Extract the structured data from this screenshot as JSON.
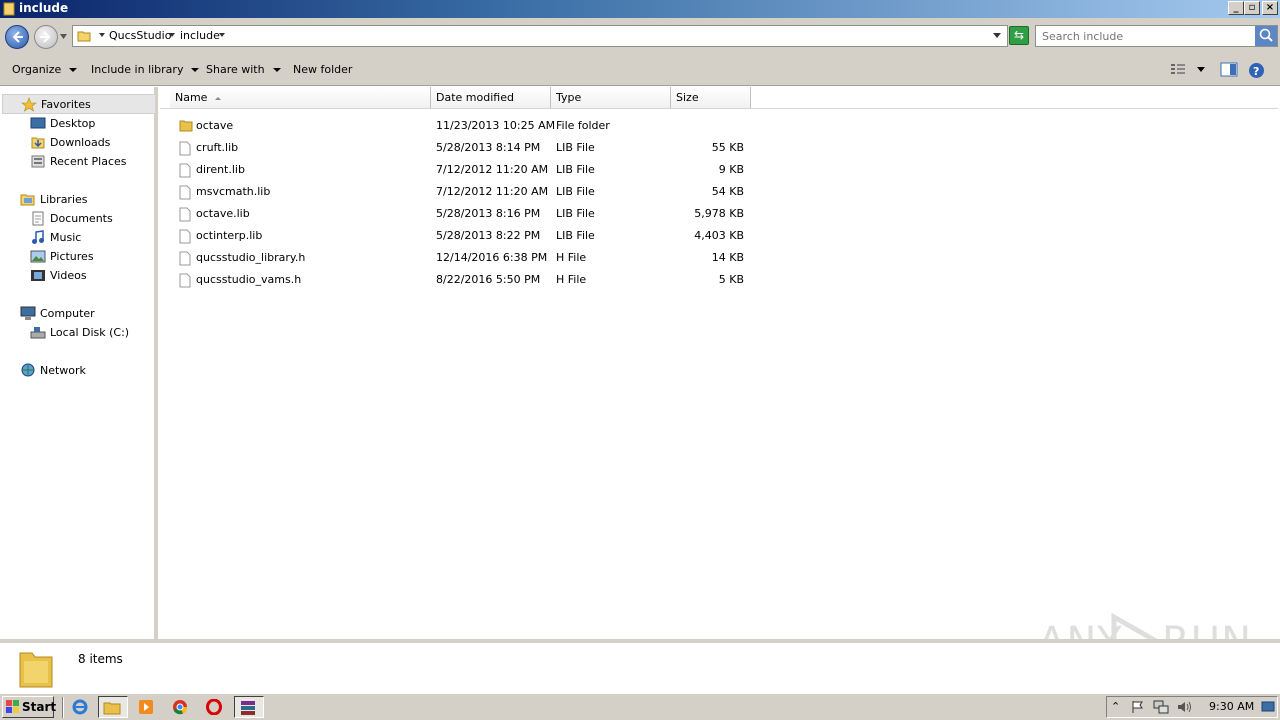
{
  "window": {
    "title": "include"
  },
  "address": {
    "crumbs": [
      "QucsStudio",
      "include"
    ],
    "search_placeholder": "Search include"
  },
  "toolbar": {
    "organize": "Organize",
    "include_in_library": "Include in library",
    "share_with": "Share with",
    "new_folder": "New folder"
  },
  "nav": {
    "favorites": "Favorites",
    "desktop": "Desktop",
    "downloads": "Downloads",
    "recent_places": "Recent Places",
    "libraries": "Libraries",
    "documents": "Documents",
    "music": "Music",
    "pictures": "Pictures",
    "videos": "Videos",
    "computer": "Computer",
    "local_disk": "Local Disk (C:)",
    "network": "Network"
  },
  "columns": {
    "name": "Name",
    "date": "Date modified",
    "type": "Type",
    "size": "Size"
  },
  "files": [
    {
      "name": "octave",
      "date": "11/23/2013 10:25 AM",
      "type": "File folder",
      "size": ""
    },
    {
      "name": "cruft.lib",
      "date": "5/28/2013 8:14 PM",
      "type": "LIB File",
      "size": "55 KB"
    },
    {
      "name": "dirent.lib",
      "date": "7/12/2012 11:20 AM",
      "type": "LIB File",
      "size": "9 KB"
    },
    {
      "name": "msvcmath.lib",
      "date": "7/12/2012 11:20 AM",
      "type": "LIB File",
      "size": "54 KB"
    },
    {
      "name": "octave.lib",
      "date": "5/28/2013 8:16 PM",
      "type": "LIB File",
      "size": "5,978 KB"
    },
    {
      "name": "octinterp.lib",
      "date": "5/28/2013 8:22 PM",
      "type": "LIB File",
      "size": "4,403 KB"
    },
    {
      "name": "qucsstudio_library.h",
      "date": "12/14/2016 6:38 PM",
      "type": "H File",
      "size": "14 KB"
    },
    {
      "name": "qucsstudio_vams.h",
      "date": "8/22/2016 5:50 PM",
      "type": "H File",
      "size": "5 KB"
    }
  ],
  "status": {
    "count": "8 items"
  },
  "watermark": {
    "text_left": "ANY",
    "text_right": "RUN"
  },
  "taskbar": {
    "start": "Start",
    "clock": "9:30 AM"
  },
  "colors": {
    "title_start": "#0a246a",
    "title_end": "#a6caf0",
    "chrome": "#d4d0c8",
    "folder": "#e8c04a"
  }
}
